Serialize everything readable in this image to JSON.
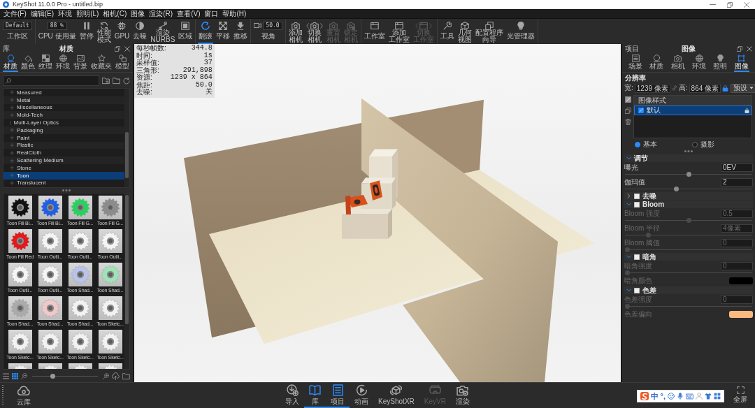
{
  "window": {
    "title": "KeyShot 11.0.0 Pro - untitled.bip"
  },
  "menu": [
    "文件(F)",
    "编辑(E)",
    "环境",
    "照明(L)",
    "相机(C)",
    "图像",
    "渲染(R)",
    "查看(V)",
    "窗口",
    "帮助(H)"
  ],
  "toolbar": [
    [
      {
        "kind": "dropdown",
        "value": "Default",
        "label": "工作区",
        "disabled": false
      }
    ],
    [
      {
        "kind": "field",
        "value": "88 %",
        "label": "CPU 使用量",
        "disabled": false
      },
      {
        "kind": "button",
        "label": "暂停",
        "disabled": false
      },
      {
        "kind": "button",
        "label": "性能模式",
        "disabled": false
      },
      {
        "kind": "button",
        "label": "GPU",
        "disabled": false
      },
      {
        "kind": "button",
        "label": "去噪",
        "disabled": false
      },
      {
        "kind": "button",
        "label": "渲染NURBS",
        "disabled": false
      },
      {
        "kind": "button",
        "label": "区域",
        "disabled": false
      }
    ],
    [
      {
        "kind": "button",
        "label": "翻滚",
        "selected": true,
        "disabled": false
      },
      {
        "kind": "button",
        "label": "平移",
        "selected": false,
        "disabled": false
      },
      {
        "kind": "button",
        "label": "推移",
        "selected": false,
        "disabled": false
      }
    ],
    [
      {
        "kind": "field",
        "value": "50.0",
        "label": "视角",
        "disabled": false
      }
    ],
    [
      {
        "kind": "button",
        "label": "添加相机",
        "disabled": false
      },
      {
        "kind": "switcher",
        "label": "切换相机",
        "disabled": false
      },
      {
        "kind": "button",
        "label": "重置相机",
        "disabled": true
      },
      {
        "kind": "button",
        "label": "锁定相机",
        "disabled": true
      }
    ],
    [
      {
        "kind": "button",
        "label": "工作室",
        "disabled": false
      },
      {
        "kind": "button",
        "label": "添加工作室",
        "disabled": false
      },
      {
        "kind": "switcher",
        "label": "切换工作室",
        "disabled": true
      }
    ],
    [
      {
        "kind": "button",
        "label": "工具",
        "disabled": false
      },
      {
        "kind": "button",
        "label": "几何视图",
        "disabled": false
      },
      {
        "kind": "button",
        "label": "配置程序向导",
        "disabled": false
      },
      {
        "kind": "button",
        "label": "光管理器",
        "disabled": false
      }
    ]
  ],
  "library": {
    "title": "库",
    "heading": "材质",
    "tabs": [
      {
        "label": "材质",
        "selected": true
      },
      {
        "label": "颜色",
        "selected": false
      },
      {
        "label": "纹理",
        "selected": false
      },
      {
        "label": "环境",
        "selected": false
      },
      {
        "label": "背景",
        "selected": false
      },
      {
        "label": "收藏夹",
        "selected": false
      },
      {
        "label": "模型",
        "selected": false
      }
    ],
    "tree": [
      {
        "label": "Measured",
        "expandable": true,
        "selected": false
      },
      {
        "label": "Metal",
        "expandable": true,
        "selected": false
      },
      {
        "label": "Miscellaneous",
        "expandable": true,
        "selected": false
      },
      {
        "label": "Mold-Tech",
        "expandable": true,
        "selected": false
      },
      {
        "label": "Multi-Layer Optics",
        "expandable": false,
        "selected": false
      },
      {
        "label": "Packaging",
        "expandable": true,
        "selected": false
      },
      {
        "label": "Paint",
        "expandable": true,
        "selected": false
      },
      {
        "label": "Plastic",
        "expandable": true,
        "selected": false
      },
      {
        "label": "RealCloth",
        "expandable": true,
        "selected": false
      },
      {
        "label": "Scattering Medium",
        "expandable": true,
        "selected": false
      },
      {
        "label": "Stone",
        "expandable": true,
        "selected": false
      },
      {
        "label": "Toon",
        "expandable": true,
        "selected": true
      },
      {
        "label": "Translucent",
        "expandable": true,
        "selected": false
      }
    ],
    "materials": [
      {
        "name": "Toon Fill Bl...",
        "color": "#111111"
      },
      {
        "name": "Toon Fill Bl...",
        "color": "#1f5fe8"
      },
      {
        "name": "Toon Fill G...",
        "color": "#22d65a"
      },
      {
        "name": "Toon Fill G...",
        "color": "#8c8c8c"
      },
      {
        "name": "Toon Fill Red",
        "color": "#e3191b"
      },
      {
        "name": "Toon Outli...",
        "color": "#f4f4f4"
      },
      {
        "name": "Toon Outli...",
        "color": "#f4f4f4"
      },
      {
        "name": "Toon Outli...",
        "color": "#f4f4f4"
      },
      {
        "name": "Toon Outli...",
        "color": "#f4f4f4"
      },
      {
        "name": "Toon Outli...",
        "color": "#f4f4f4"
      },
      {
        "name": "Toon Shad...",
        "color": "#b9c4ec"
      },
      {
        "name": "Toon Shad...",
        "color": "#9fe3b8"
      },
      {
        "name": "Toon Shad...",
        "color": "#ababab"
      },
      {
        "name": "Toon Shad...",
        "color": "#f2c8c8"
      },
      {
        "name": "Toon Shad...",
        "color": "#f2f2f2"
      },
      {
        "name": "Toon Sketc...",
        "color": "#f2f2f2"
      },
      {
        "name": "Toon Sketc...",
        "color": "#f2f2f2"
      },
      {
        "name": "Toon Sketc...",
        "color": "#f2f2f2"
      },
      {
        "name": "Toon Sketc...",
        "color": "#f2f2f2"
      },
      {
        "name": "Toon Sketc...",
        "color": "#f2f2f2"
      },
      {
        "color": "#eeeeee"
      },
      {
        "color": "#eeeeee"
      },
      {
        "color": "#eeeeee"
      },
      {
        "color": "#eeeeee"
      }
    ],
    "view_modes": [
      {
        "selected": false
      },
      {
        "selected": true
      }
    ],
    "thumb_size": {
      "level": 0.3
    }
  },
  "stats": [
    {
      "label": "每秒帧数:",
      "value": "344.8"
    },
    {
      "label": "时间:",
      "value": "1s"
    },
    {
      "label": "采样值:",
      "value": "37"
    },
    {
      "label": "三角形:",
      "value": "291,898"
    },
    {
      "label": "资源:",
      "value": "1239 x 864"
    },
    {
      "label": "焦距:",
      "value": "50.0"
    },
    {
      "label": "去噪:",
      "value": "关"
    }
  ],
  "project": {
    "title": "项目",
    "heading": "图像",
    "tabs": [
      {
        "label": "场景",
        "selected": false
      },
      {
        "label": "材质",
        "selected": false
      },
      {
        "label": "相机",
        "selected": false
      },
      {
        "label": "环境",
        "selected": false
      },
      {
        "label": "照明",
        "selected": false
      },
      {
        "label": "图像",
        "selected": true
      }
    ],
    "resolution": {
      "title": "分辨率",
      "width_label": "宽:",
      "width": "1239 像素",
      "height_label": "高:",
      "height": "864 像素",
      "locked": true,
      "preset": "预设"
    },
    "styles": {
      "header": "图像样式",
      "items": [
        {
          "label": "默认",
          "selected": true,
          "locked": true
        }
      ]
    },
    "modes": [
      {
        "label": "基本",
        "selected": true
      },
      {
        "label": "摄影",
        "selected": false
      }
    ],
    "adjust": {
      "title": "调节",
      "expanded": true,
      "rows": [
        {
          "kind": "slider",
          "label": "曝光",
          "value": "0EV",
          "level": 0.5,
          "disabled": false
        },
        {
          "kind": "slider",
          "label": "伽玛值",
          "value": "2",
          "level": 0.4,
          "disabled": false
        }
      ]
    },
    "effects": [
      {
        "title": "去噪",
        "expanded": false,
        "checked": false
      },
      {
        "title": "Bloom",
        "expanded": true,
        "checked": false,
        "rows": [
          {
            "kind": "slider",
            "label": "Bloom 强度",
            "value": "0.5",
            "level": 0.5,
            "disabled": true
          },
          {
            "kind": "slider",
            "label": "Bloom 半径",
            "value": "4像素",
            "level": 0.17,
            "disabled": true
          },
          {
            "kind": "slider",
            "label": "Bloom 阈值",
            "value": "0",
            "level": 0,
            "disabled": true
          }
        ]
      },
      {
        "title": "暗角",
        "expanded": true,
        "checked": false,
        "rows": [
          {
            "kind": "slider",
            "label": "暗角强度",
            "value": "0",
            "level": 0,
            "disabled": true
          },
          {
            "kind": "color",
            "label": "暗角颜色",
            "color": "#000000",
            "disabled": true
          }
        ]
      },
      {
        "title": "色差",
        "expanded": true,
        "checked": false,
        "rows": [
          {
            "kind": "slider",
            "label": "色差强度",
            "value": "0",
            "level": 0,
            "disabled": true
          },
          {
            "kind": "color",
            "label": "色差偏向",
            "color": "#fbb97f",
            "disabled": true
          }
        ]
      }
    ]
  },
  "dock": {
    "cloud": "云库",
    "buttons": [
      {
        "label": "导入",
        "selected": false,
        "disabled": false
      },
      {
        "label": "库",
        "selected": true,
        "disabled": false
      },
      {
        "label": "项目",
        "selected": true,
        "disabled": false
      },
      {
        "label": "动画",
        "selected": false,
        "disabled": false
      },
      {
        "label": "KeyShotXR",
        "selected": false,
        "disabled": false
      },
      {
        "label": "KeyVR",
        "selected": false,
        "disabled": true
      },
      {
        "label": "渲染",
        "selected": false,
        "disabled": false
      }
    ],
    "fullscreen": "全屏"
  },
  "ime_bar": {
    "mode": "中",
    "punctuation": "°,"
  }
}
